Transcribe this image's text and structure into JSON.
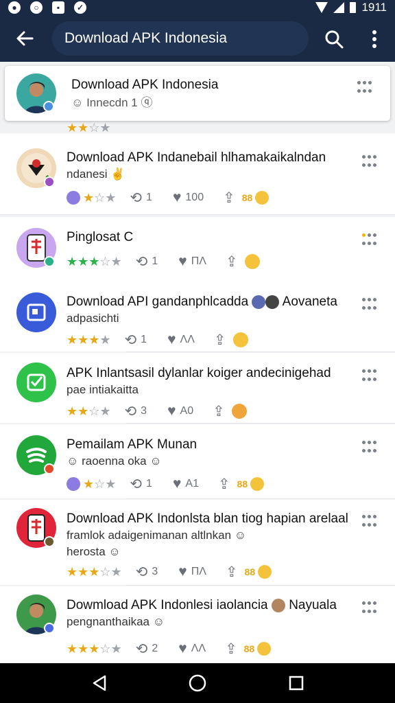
{
  "status_bar": {
    "time": "1911",
    "icons": [
      "notification-icon",
      "record-icon",
      "image-icon",
      "shield-icon",
      "wifi-icon",
      "signal-icon",
      "battery-icon"
    ]
  },
  "header": {
    "search_value": "Download APK Indonesia",
    "back_icon": "arrow-back-icon",
    "search_icon": "search-icon",
    "more_icon": "more-vertical-icon"
  },
  "items": [
    {
      "title": "Download APK Indonesia",
      "subtitle": "☺ Innecdn 1 ⓠ",
      "rating": 2
    },
    {
      "title": "Download APK Indanebail hlhamakaikalndan",
      "subtitle": "ndanesi ✌",
      "rating": 1.5,
      "repost": "1",
      "likes": "100"
    },
    {
      "title": "Pinglosat C",
      "rating": 3.5,
      "repost": "1",
      "likes": "ΠΛ"
    },
    {
      "title": "Download API gandanphlcadda",
      "title_suffix": "Aovaneta",
      "subtitle": "adpasichti",
      "rating": 3,
      "repost": "1",
      "likes": "ΛΛ"
    },
    {
      "title": "APK Inlantsasil dylanlar koiger andecinigehad",
      "subtitle": "pae intiakaitta",
      "rating": 2.5,
      "repost": "3",
      "likes": "A0"
    },
    {
      "title": "Pemailam APK Munan",
      "subtitle": "☺ raoenna oka ☺",
      "rating": 1.5,
      "repost": "1",
      "likes": "A1"
    },
    {
      "title": "Download APK Indonlsta blan tiog hapian arelaal",
      "subtitle": "framlok adaigenimanan altlnkan ☺",
      "subtitle2": "herosta ☺",
      "rating": 3.5,
      "repost": "3",
      "likes": "ΠΛ"
    },
    {
      "title": "Dowmload APK Indonlesi iaolancia",
      "title_suffix": "Nayuala",
      "subtitle": "pengnanthaikaa ☺",
      "rating": 3.5,
      "repost": "2",
      "likes": "ΛΛ"
    }
  ],
  "score_text": "88",
  "colors": {
    "appbar": "#1a2a44",
    "star_gold": "#e8a815",
    "star_green": "#2bb04a",
    "navbar": "#000000"
  }
}
